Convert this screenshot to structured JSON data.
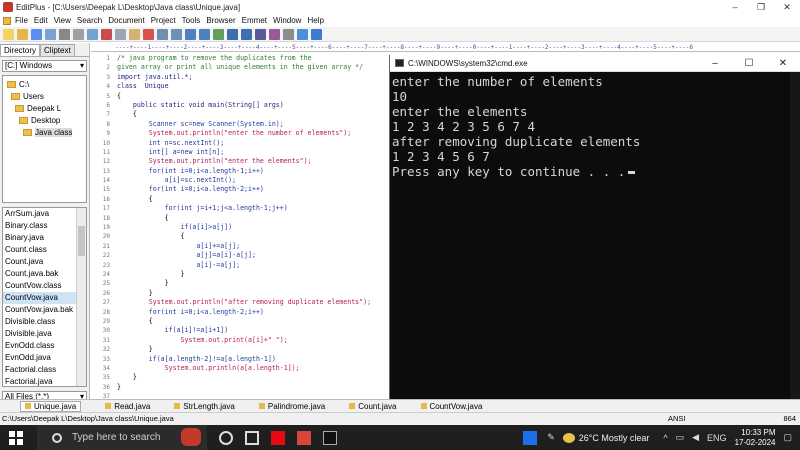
{
  "editplus": {
    "title": "EditPlus - [C:\\Users\\Deepak L\\Desktop\\Java class\\Unique.java]",
    "menu": [
      "File",
      "Edit",
      "View",
      "Search",
      "Document",
      "Project",
      "Tools",
      "Browser",
      "Emmet",
      "Window",
      "Help"
    ],
    "left_tabs": [
      "Directory",
      "Cliptext"
    ],
    "drive": "[C:] Windows",
    "folders": [
      "C:\\",
      "Users",
      "Deepak L",
      "Desktop",
      "Java class"
    ],
    "files": [
      "ArrSum.java",
      "Binary.class",
      "Binary.java",
      "Count.class",
      "Count.java",
      "Count.java.bak",
      "CountVow.class",
      "CountVow.java",
      "CountVow.java.bak",
      "Divisible.class",
      "Divisible.java",
      "EvnOdd.class",
      "EvnOdd.java",
      "Factorial.class",
      "Factorial.java"
    ],
    "filter": "All Files (*.*)",
    "ruler": "----+----1----+----2----+----3----+----4----+----5----+----6----+----7----+----8----+----9----+----0----+----1----+----2----+----3----+----4----+----5----+----6",
    "line_numbers": [
      "1",
      "2",
      "3",
      "4",
      "5",
      "6",
      "7",
      "8",
      "9",
      "10",
      "11",
      "12",
      "13",
      "14",
      "15",
      "16",
      "17",
      "18",
      "19",
      "20",
      "21",
      "22",
      "23",
      "24",
      "25",
      "26",
      "27",
      "28",
      "29",
      "30",
      "31",
      "32",
      "33",
      "34",
      "35",
      "36",
      "37",
      "38"
    ],
    "code_lines": [
      "/* java program to remove the duplicates from the",
      "given array or print all unique elements in the given array */",
      "import java.util.*;",
      "class  Unique",
      "{",
      "    public static void main(String[] args)",
      "    {",
      "        Scanner sc=new Scanner(System.in);",
      "        System.out.println(\"enter the number of elements\");",
      "        int n=sc.nextInt();",
      "        int[] a=new int[n];",
      "        System.out.println(\"enter the elements\");",
      "        for(int i=0;i<a.length-1;i++)",
      "            a[i]=sc.nextInt();",
      "        for(int i=0;i<a.length-2;i++)",
      "        {",
      "            for(int j=i+1;j<a.length-1;j++)",
      "            {",
      "                if(a[i]>a[j])",
      "                {",
      "                    a[i]+=a[j];",
      "                    a[j]=a[i]-a[j];",
      "                    a[i]-=a[j];",
      "                }",
      "            }",
      "        }",
      "        System.out.println(\"after removing duplicate elements\");",
      "        for(int i=0;i<a.length-2;i++)",
      "        {",
      "            if(a[i]!=a[i+1])",
      "                System.out.print(a[i]+\" \");",
      "        }",
      "        if(a[a.length-2]!=a[a.length-1])",
      "            System.out.println(a[a.length-1]);",
      "    }",
      "}",
      "",
      ""
    ],
    "open_tabs": [
      "Unique.java",
      "Read.java",
      "StrLength.java",
      "Palindrome.java",
      "Count.java",
      "CountVow.java"
    ],
    "status_path": "C:\\Users\\Deepak L\\Desktop\\Java class\\Unique.java",
    "status_encoding": "ANSI",
    "status_right": "864"
  },
  "cmd": {
    "title": "C:\\WINDOWS\\system32\\cmd.exe",
    "output": [
      "enter the number of elements",
      "10",
      "enter the elements",
      "1 2 3 4 2 3 5 6 7 4",
      "after removing duplicate elements",
      "1 2 3 4 5 6 7",
      "Press any key to continue . . ."
    ]
  },
  "taskbar": {
    "search_placeholder": "Type here to search",
    "weather": "26°C  Mostly clear",
    "language": "ENG",
    "time": "10:33 PM",
    "date": "17-02-2024"
  }
}
